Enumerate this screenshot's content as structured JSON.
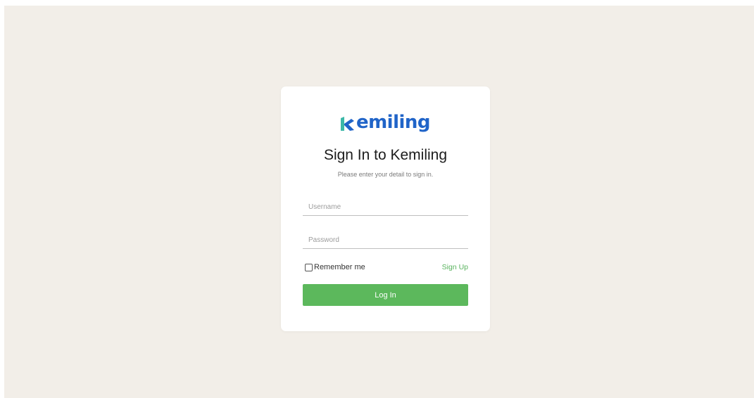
{
  "brand": {
    "name": "emiling",
    "logo_icon": "kemiling-k-logo-icon",
    "color_primary": "#2064c8",
    "color_secondary": "#3cb8a8"
  },
  "login": {
    "title": "Sign In to Kemiling",
    "subtitle": "Please enter your detail to sign in.",
    "username_placeholder": "Username",
    "password_placeholder": "Password",
    "remember_label": "Remember me",
    "signup_label": "Sign Up",
    "login_button_label": "Log In"
  },
  "colors": {
    "background": "#f2eee8",
    "card": "#ffffff",
    "accent_green": "#5cb85c"
  }
}
